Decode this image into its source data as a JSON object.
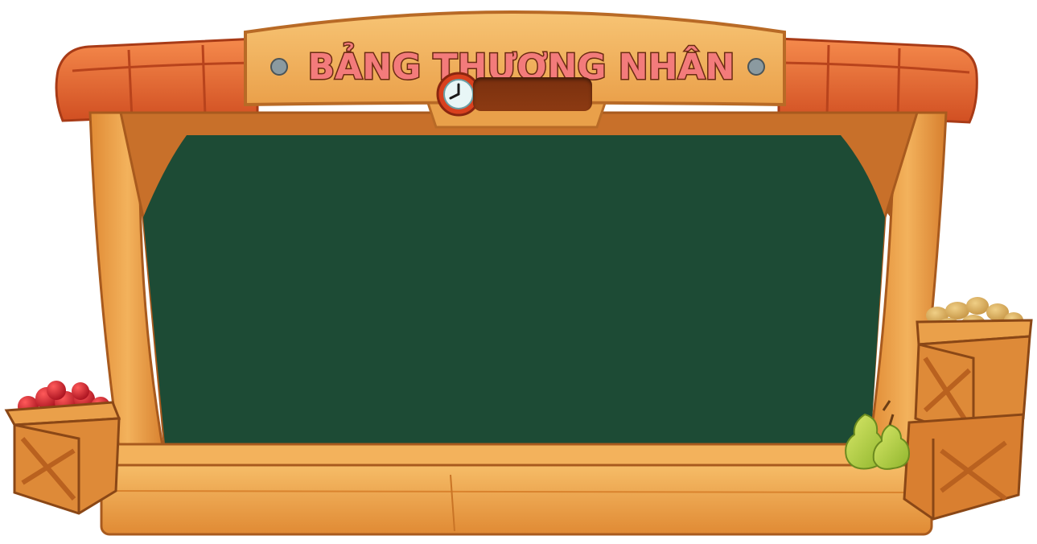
{
  "title": "BẢNG THƯƠNG NHÂN",
  "timer": {
    "value": ""
  },
  "board": {
    "content": ""
  },
  "colors": {
    "board": "#1d4b35",
    "wood_light": "#f3b25c",
    "wood_mid": "#e8943b",
    "wood_dark": "#b9611f",
    "roof": "#e8662f",
    "roof_dark": "#b8431c",
    "title_fill": "#f37b7b",
    "title_stroke": "#6b2a12"
  },
  "icons": {
    "timer": "clock-icon",
    "left_crate": "apple-crate-icon",
    "right_crate": "potato-crate-icon",
    "pears": "pear-icon"
  }
}
